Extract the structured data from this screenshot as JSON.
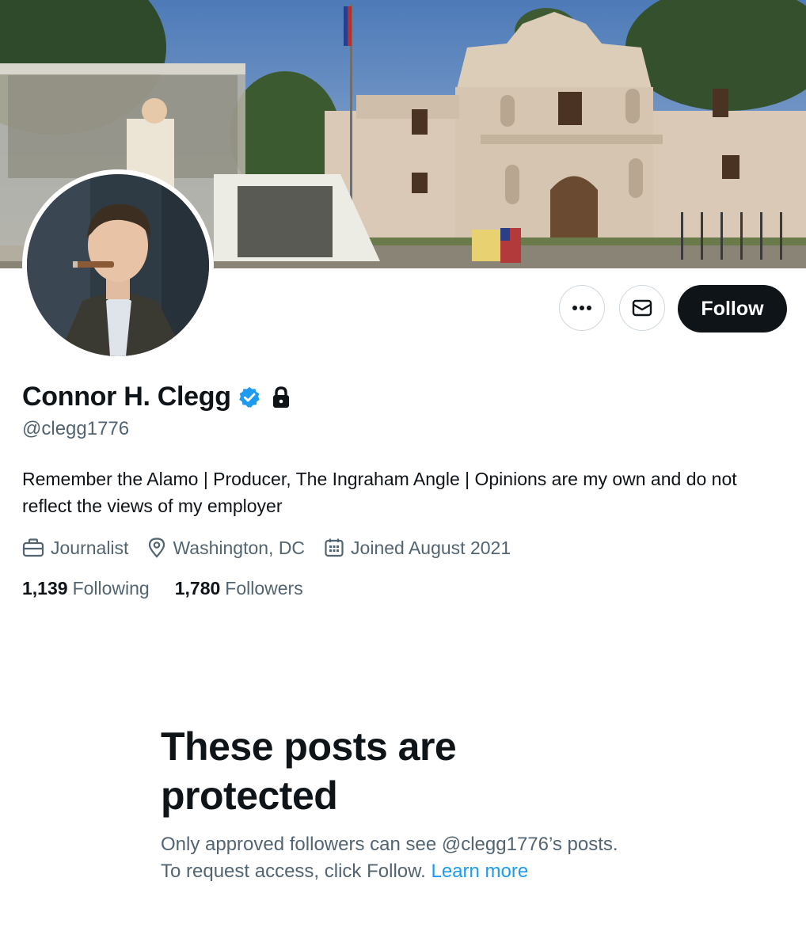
{
  "profile": {
    "display_name": "Connor H. Clegg",
    "handle": "@clegg1776",
    "bio": "Remember the Alamo | Producer, The Ingraham Angle | Opinions are my own and do not reflect the views of my employer",
    "meta": {
      "profession": "Journalist",
      "location": "Washington, DC",
      "joined": "Joined August 2021"
    },
    "stats": {
      "following_count": "1,139",
      "following_label": "Following",
      "followers_count": "1,780",
      "followers_label": "Followers"
    },
    "verified_icon": "verified-badge-icon",
    "protected_icon": "lock-icon"
  },
  "actions": {
    "more_icon": "more-horizontal-icon",
    "message_icon": "envelope-icon",
    "follow_label": "Follow"
  },
  "protected_notice": {
    "title": "These posts are protected",
    "line1": "Only approved followers can see @clegg1776’s posts.",
    "line2": "To request access, click Follow.",
    "link": "Learn more"
  },
  "colors": {
    "accent": "#1d9bf0",
    "text_primary": "#0f1419",
    "text_secondary": "#536471",
    "follow_button": "#0f1419"
  }
}
